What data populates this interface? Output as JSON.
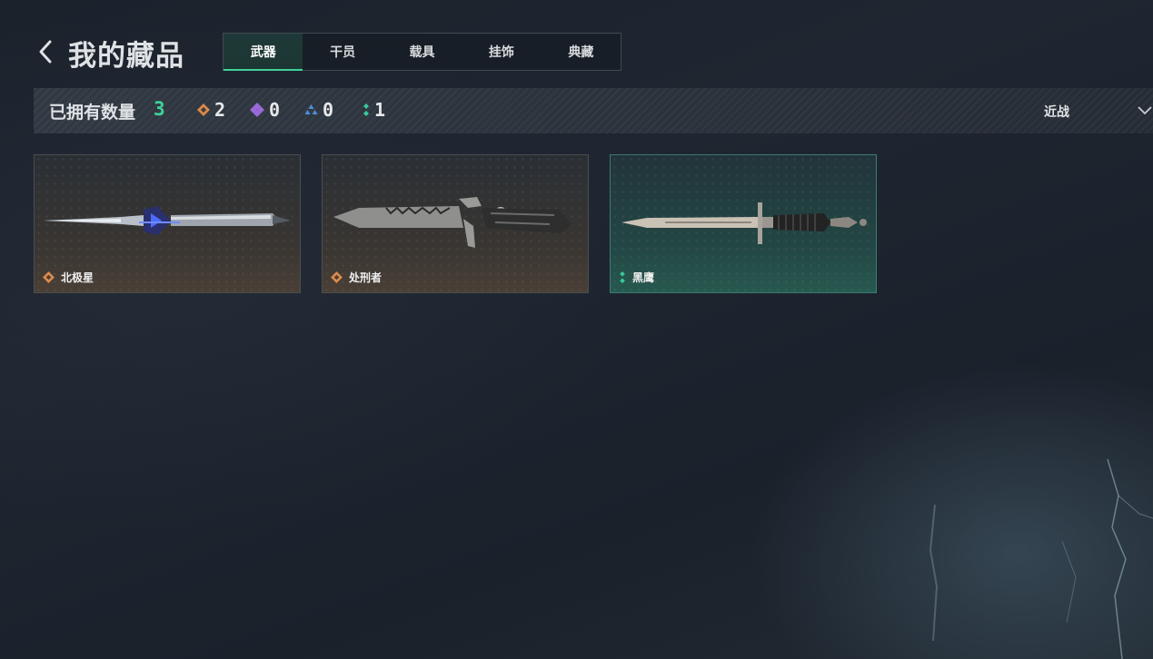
{
  "header": {
    "title": "我的藏品",
    "tabs": [
      {
        "label": "武器",
        "active": true
      },
      {
        "label": "干员",
        "active": false
      },
      {
        "label": "载具",
        "active": false
      },
      {
        "label": "挂饰",
        "active": false
      },
      {
        "label": "典藏",
        "active": false
      }
    ]
  },
  "summary": {
    "owned_label": "已拥有数量",
    "owned_count": "3",
    "rarity_counts": [
      {
        "icon": "orange-diamond-icon",
        "color": "#d98a4a",
        "count": "2"
      },
      {
        "icon": "purple-diamond-icon",
        "color": "#9a6ad8",
        "count": "0"
      },
      {
        "icon": "blue-triangle-icon",
        "color": "#4f8fd8",
        "count": "0"
      },
      {
        "icon": "green-dots-icon",
        "color": "#39c99a",
        "count": "1"
      }
    ],
    "filter": {
      "selected": "近战"
    }
  },
  "items": [
    {
      "name": "北极星",
      "rarity_icon": "orange-diamond-icon",
      "rarity_color": "#d98a4a"
    },
    {
      "name": "处刑者",
      "rarity_icon": "orange-diamond-icon",
      "rarity_color": "#d98a4a"
    },
    {
      "name": "黑鹰",
      "rarity_icon": "green-dots-icon",
      "rarity_color": "#39c99a"
    }
  ],
  "colors": {
    "accent": "#3fd29a"
  }
}
